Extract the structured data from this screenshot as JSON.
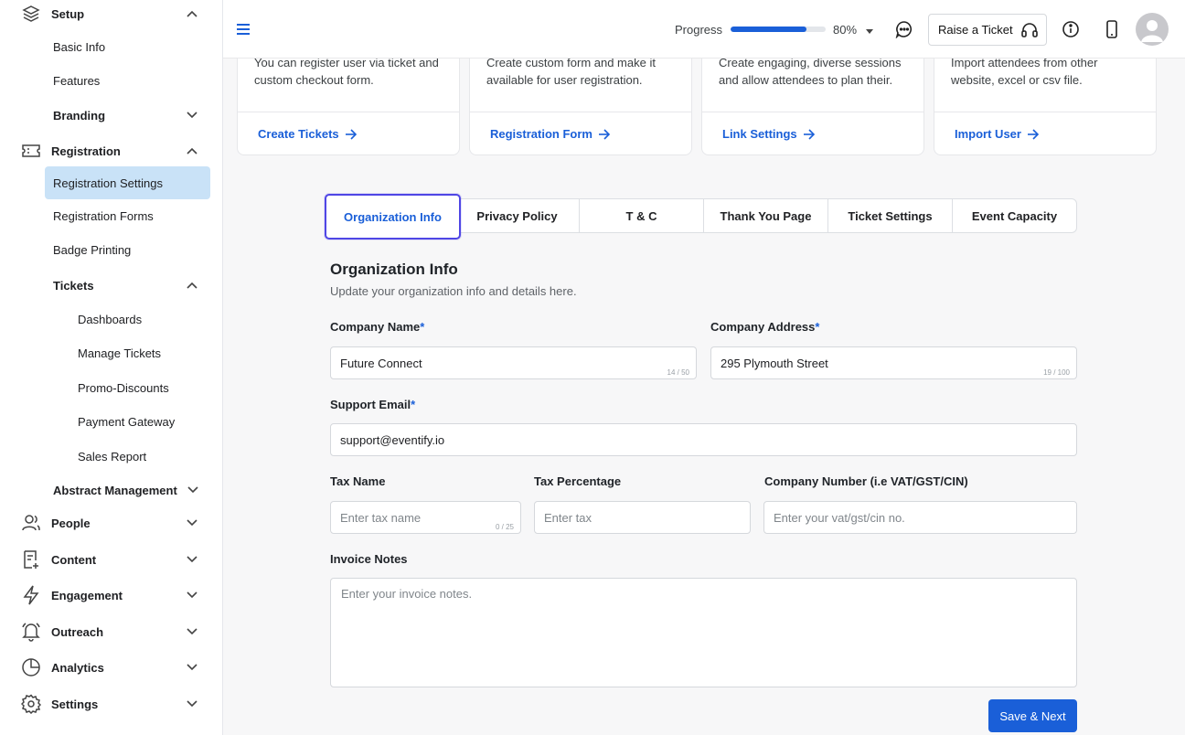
{
  "sidebar": {
    "setup": "Setup",
    "basic_info": "Basic Info",
    "features": "Features",
    "branding": "Branding",
    "registration": "Registration",
    "registration_settings": "Registration Settings",
    "registration_forms": "Registration Forms",
    "badge_printing": "Badge Printing",
    "tickets": "Tickets",
    "dashboards": "Dashboards",
    "manage_tickets": "Manage Tickets",
    "promo_discounts": "Promo-Discounts",
    "payment_gateway": "Payment Gateway",
    "sales_report": "Sales Report",
    "abstract_management": "Abstract Management",
    "people": "People",
    "content": "Content",
    "engagement": "Engagement",
    "outreach": "Outreach",
    "analytics": "Analytics",
    "settings": "Settings"
  },
  "topbar": {
    "progress_label": "Progress",
    "progress_percent_text": "80%",
    "progress_value": 0.8,
    "raise_ticket": "Raise a Ticket"
  },
  "cards": [
    {
      "desc": "You can register user via ticket and custom checkout form.",
      "cta": "Create Tickets"
    },
    {
      "desc": "Create custom form and make it available for user registration.",
      "cta": "Registration Form"
    },
    {
      "desc": "Create engaging, diverse sessions and allow attendees to plan their.",
      "cta": "Link Settings"
    },
    {
      "desc": "Import attendees from other website, excel or csv file.",
      "cta": "Import User"
    }
  ],
  "tabs": {
    "org_info": "Organization Info",
    "privacy": "Privacy Policy",
    "tc": "T & C",
    "thank_you": "Thank You Page",
    "ticket_settings": "Ticket Settings",
    "event_capacity": "Event Capacity"
  },
  "form": {
    "title": "Organization Info",
    "subtitle": "Update your organization info and details here.",
    "company_name_label": "Company Name",
    "company_name_value": "Future Connect",
    "company_name_count": "14 / 50",
    "company_address_label": "Company Address",
    "company_address_value": "295 Plymouth Street",
    "company_address_count": "19 / 100",
    "support_email_label": "Support Email",
    "support_email_value": "support@eventify.io",
    "tax_name_label": "Tax Name",
    "tax_name_placeholder": "Enter tax name",
    "tax_name_count": "0 / 25",
    "tax_percentage_label": "Tax Percentage",
    "tax_percentage_placeholder": "Enter tax",
    "company_number_label": "Company Number (i.e VAT/GST/CIN)",
    "company_number_placeholder": "Enter your vat/gst/cin no.",
    "invoice_notes_label": "Invoice Notes",
    "invoice_notes_placeholder": "Enter your invoice notes.",
    "required_mark": "*",
    "save_label": "Save & Next"
  }
}
